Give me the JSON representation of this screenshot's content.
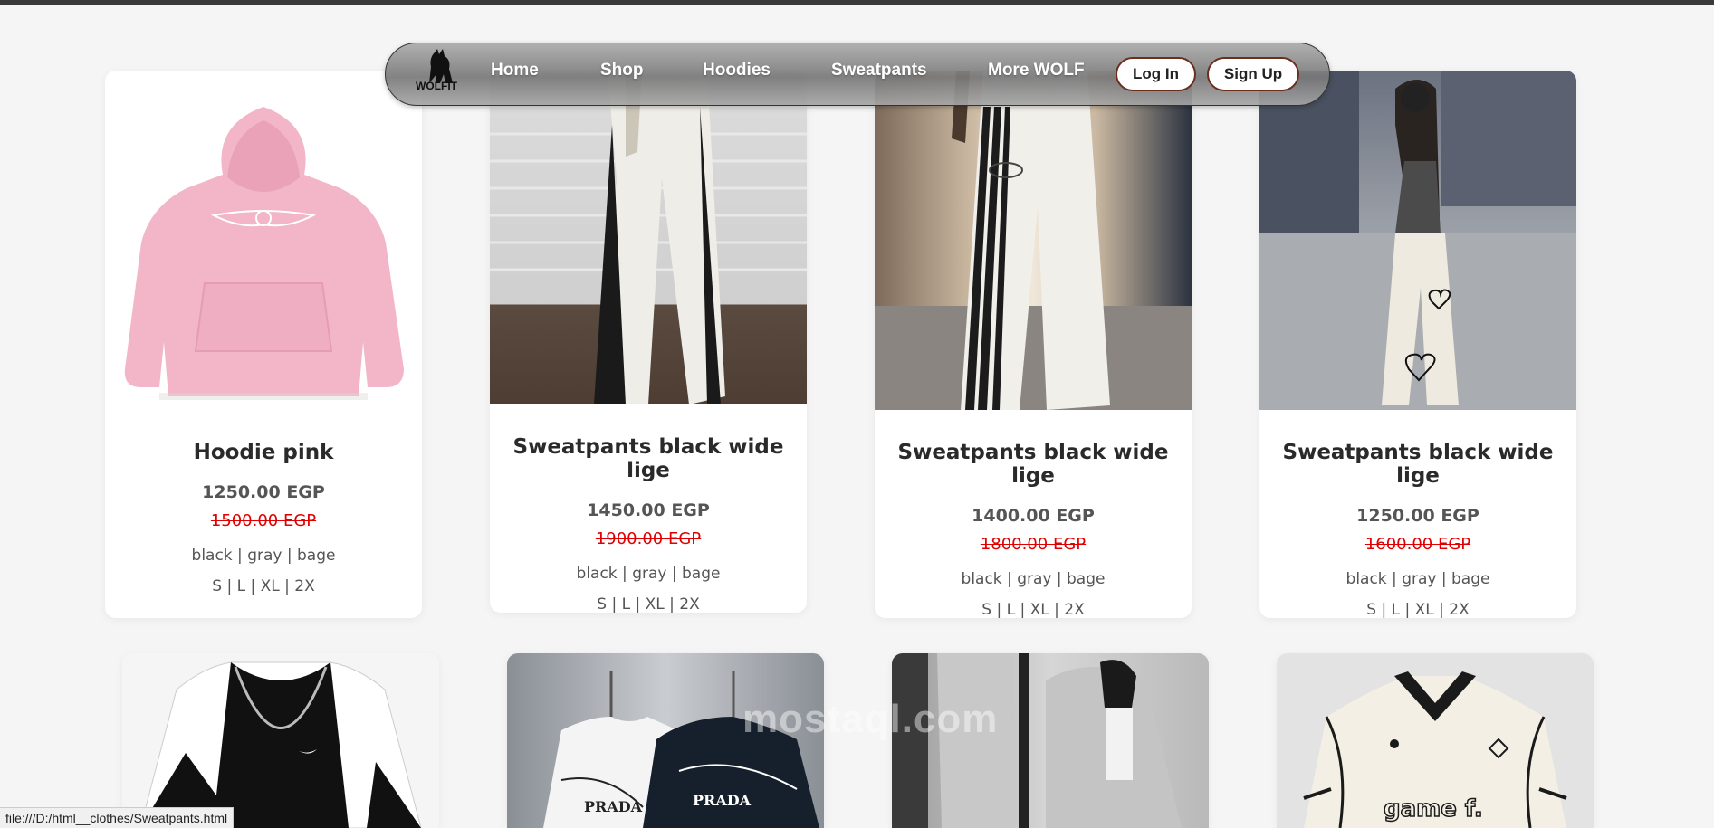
{
  "nav": {
    "logo_text": "WOLFIT",
    "links": [
      "Home",
      "Shop",
      "Hoodies",
      "Sweatpants",
      "More WOLF"
    ],
    "login_label": "Log In",
    "signup_label": "Sign Up"
  },
  "products": [
    {
      "title": "Hoodie pink",
      "price": "1250.00 EGP",
      "old_price": "1500.00 EGP",
      "colors": "black | gray | bage",
      "sizes": "S | L | XL | 2X"
    },
    {
      "title": "Sweatpants black wide lige",
      "price": "1450.00 EGP",
      "old_price": "1900.00 EGP",
      "colors": "black | gray | bage",
      "sizes": "S | L | XL | 2X"
    },
    {
      "title": "Sweatpants black wide lige",
      "price": "1400.00 EGP",
      "old_price": "1800.00 EGP",
      "colors": "black | gray | bage",
      "sizes": "S | L | XL | 2X"
    },
    {
      "title": "Sweatpants black wide lige",
      "price": "1250.00 EGP",
      "old_price": "1600.00 EGP",
      "colors": "black | gray | bage",
      "sizes": "S | L | XL | 2X"
    }
  ],
  "second_row_images": [
    "nike-sweater",
    "prada-sweatshirts",
    "gray-tracksuit",
    "football-jersey"
  ],
  "jersey_text": "game f.",
  "prada_text": "PRADA",
  "watermark": "mostaql.com",
  "status_url": "file:///D:/html__clothes/Sweatpants.html",
  "colors": {
    "accent_border": "#6b2e1c",
    "old_price": "#e00000"
  }
}
